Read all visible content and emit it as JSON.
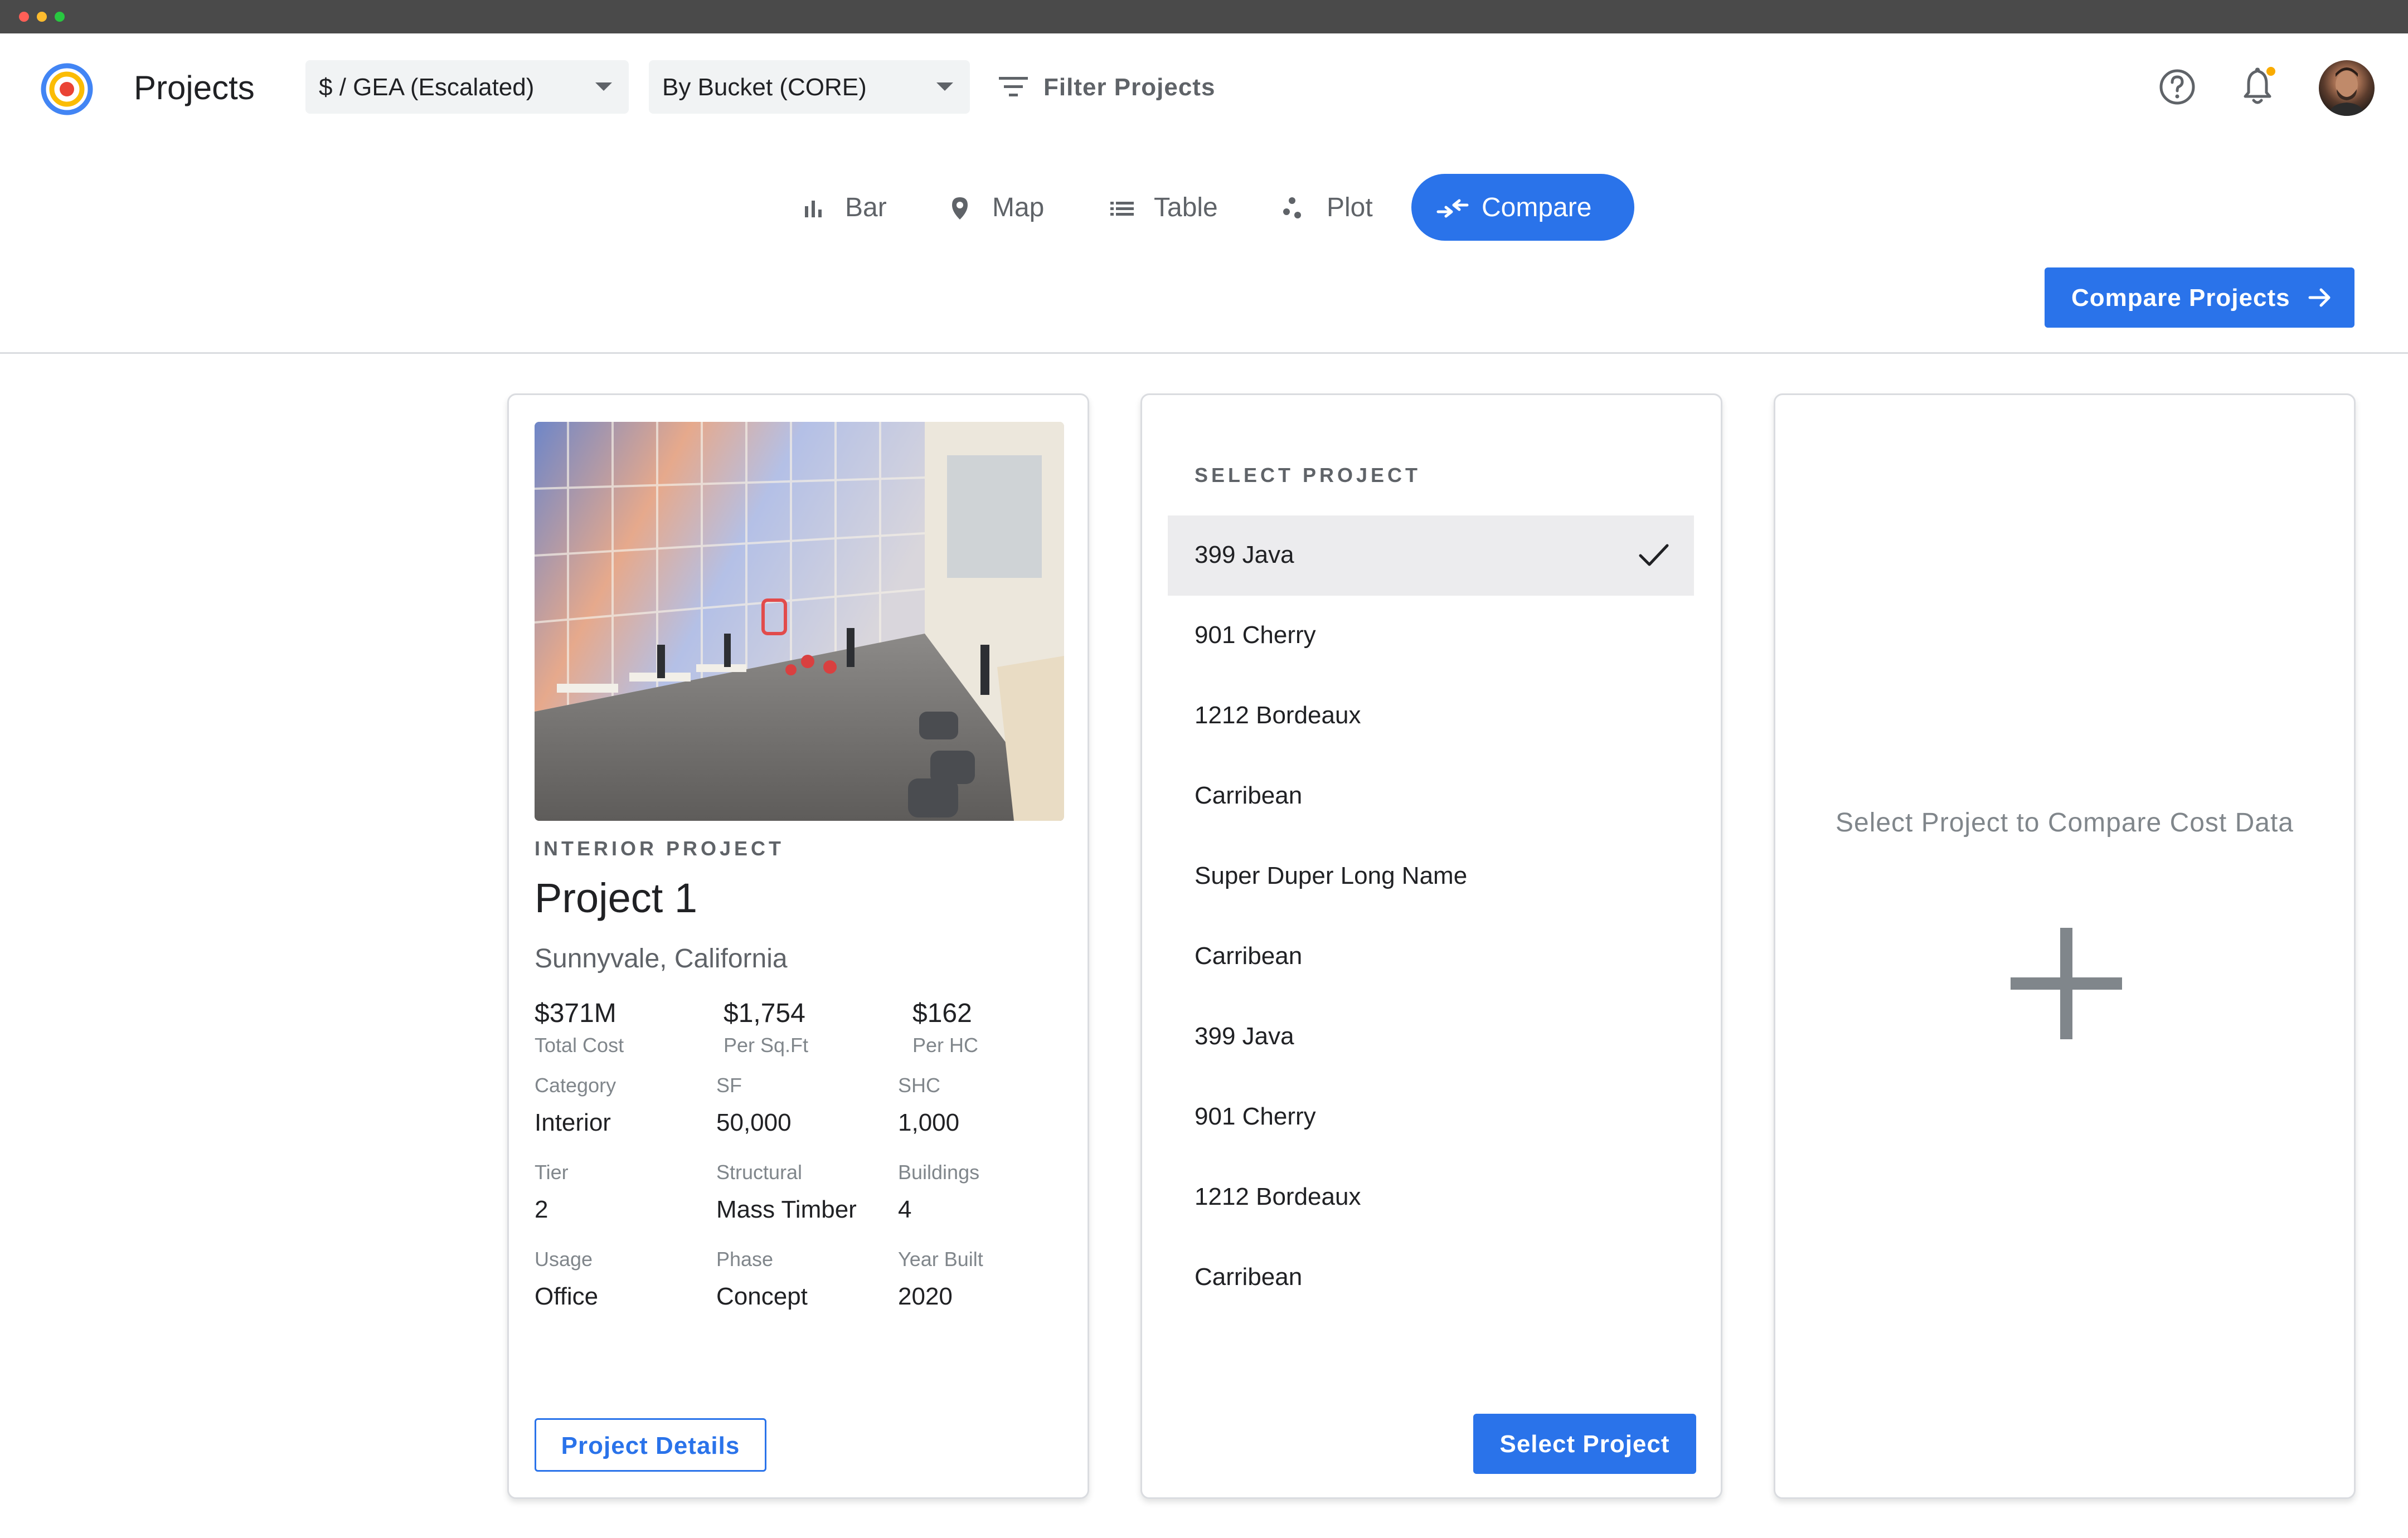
{
  "window": {
    "dots": [
      "#ff5f57",
      "#febc2e",
      "#28c840"
    ]
  },
  "app": {
    "title": "Projects"
  },
  "toolbar": {
    "metric_select": "$ / GEA (Escalated)",
    "group_select": "By Bucket (CORE)",
    "filter_label": "Filter Projects",
    "help_icon": "help-circle-icon",
    "notifications_icon": "bell-icon",
    "has_unread_notifications": true
  },
  "views": {
    "active": "Compare",
    "tabs": [
      {
        "label": "Bar",
        "icon": "bar-chart-icon"
      },
      {
        "label": "Map",
        "icon": "map-pin-icon"
      },
      {
        "label": "Table",
        "icon": "list-icon"
      },
      {
        "label": "Plot",
        "icon": "scatter-plot-icon"
      },
      {
        "label": "Compare",
        "icon": "compare-arrows-icon"
      }
    ]
  },
  "compare_button": {
    "label": "Compare Projects",
    "icon": "arrow-right-icon"
  },
  "project_card": {
    "eyebrow": "INTERIOR PROJECT",
    "title": "Project 1",
    "location": "Sunnyvale, California",
    "metrics": [
      {
        "value": "$371M",
        "label": "Total Cost"
      },
      {
        "value": "$1,754",
        "label": "Per Sq.Ft"
      },
      {
        "value": "$162",
        "label": "Per HC"
      }
    ],
    "attributes": [
      {
        "label": "Category",
        "value": "Interior"
      },
      {
        "label": "SF",
        "value": "50,000"
      },
      {
        "label": "SHC",
        "value": "1,000"
      },
      {
        "label": "Tier",
        "value": "2"
      },
      {
        "label": "Structural",
        "value": "Mass Timber"
      },
      {
        "label": "Buildings",
        "value": "4"
      },
      {
        "label": "Usage",
        "value": "Office"
      },
      {
        "label": "Phase",
        "value": "Concept"
      },
      {
        "label": "Year Built",
        "value": "2020"
      }
    ],
    "details_button": "Project Details"
  },
  "select_card": {
    "heading": "SELECT PROJECT",
    "items": [
      {
        "label": "399 Java",
        "selected": true
      },
      {
        "label": "901 Cherry",
        "selected": false
      },
      {
        "label": "1212 Bordeaux",
        "selected": false
      },
      {
        "label": "Carribean",
        "selected": false
      },
      {
        "label": "Super Duper Long Name",
        "selected": false
      },
      {
        "label": "Carribean",
        "selected": false
      },
      {
        "label": "399 Java",
        "selected": false
      },
      {
        "label": "901 Cherry",
        "selected": false
      },
      {
        "label": "1212 Bordeaux",
        "selected": false
      },
      {
        "label": "Carribean",
        "selected": false
      }
    ],
    "select_button": "Select Project"
  },
  "empty_card": {
    "message": "Select Project to Compare Cost Data",
    "icon": "plus-icon"
  },
  "colors": {
    "accent": "#2a73ea",
    "notification_dot": "#f9ab00",
    "selected_row": "#ececee"
  }
}
